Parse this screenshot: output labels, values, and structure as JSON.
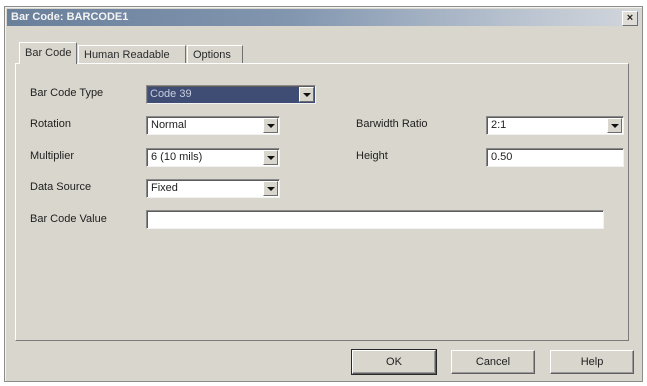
{
  "window": {
    "title": "Bar Code: BARCODE1"
  },
  "tabs": [
    {
      "label": "Bar Code"
    },
    {
      "label": "Human Readable"
    },
    {
      "label": "Options"
    }
  ],
  "form": {
    "barcode_type": {
      "label": "Bar Code Type",
      "value": "Code 39"
    },
    "rotation": {
      "label": "Rotation",
      "value": "Normal"
    },
    "multiplier": {
      "label": "Multiplier",
      "value": "6  (10 mils)"
    },
    "data_source": {
      "label": "Data Source",
      "value": "Fixed"
    },
    "barcode_value": {
      "label": "Bar Code Value",
      "value": ""
    },
    "barwidth_ratio": {
      "label": "Barwidth Ratio",
      "value": "2:1"
    },
    "height": {
      "label": "Height",
      "value": "0.50"
    }
  },
  "buttons": {
    "ok": "OK",
    "cancel": "Cancel",
    "help": "Help"
  },
  "icons": {
    "close": "close-icon",
    "dropdown": "chevron-down-icon"
  },
  "colors": {
    "selection": "#3f4c73",
    "dialog_bg": "#d9d6ce"
  }
}
